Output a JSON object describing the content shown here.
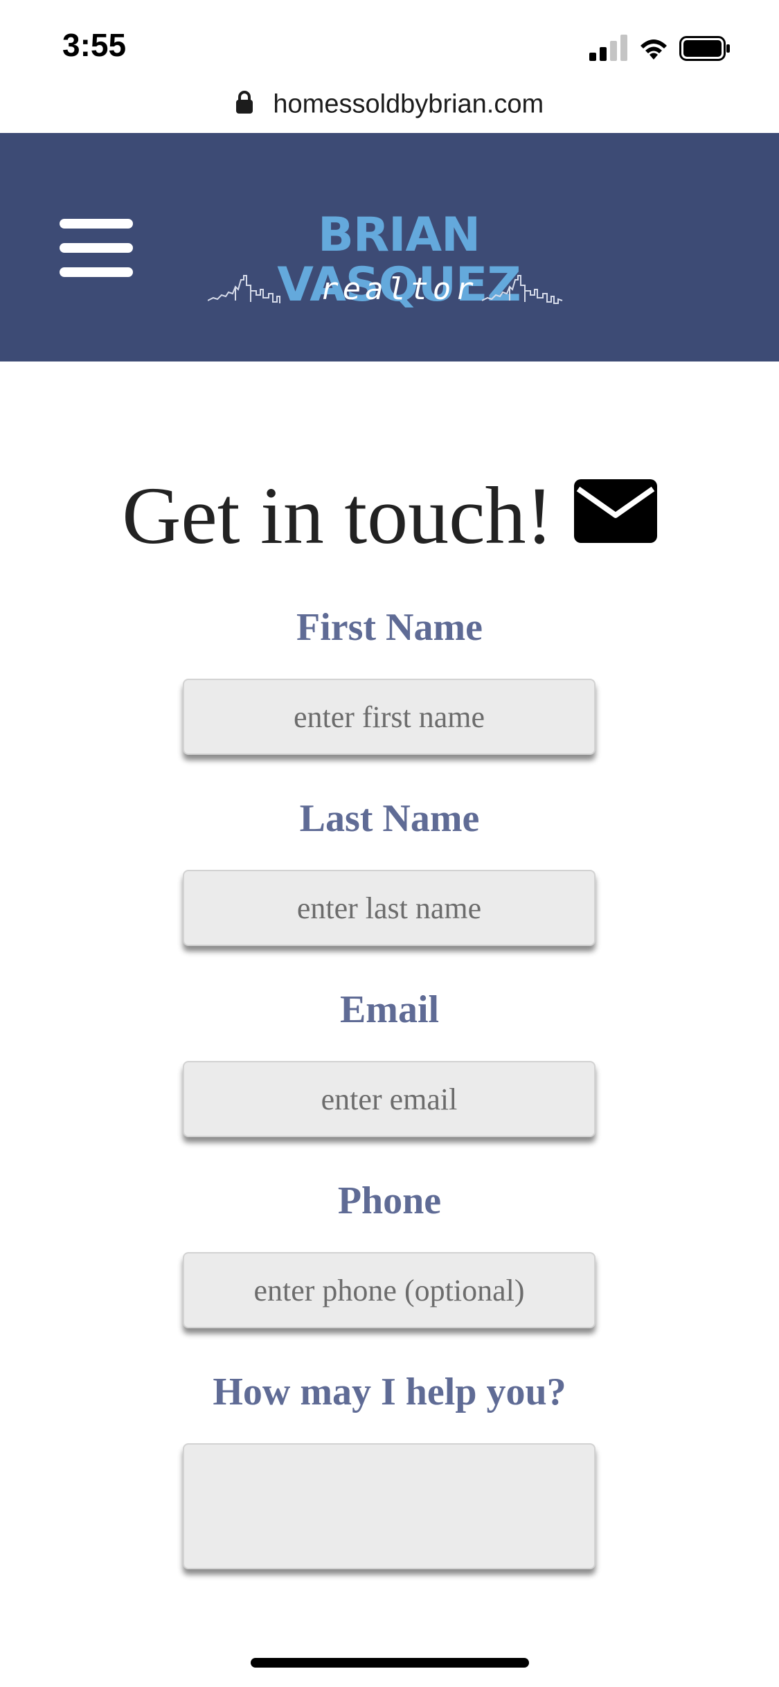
{
  "status_bar": {
    "time": "3:55",
    "icons": [
      "signal-icon",
      "wifi-icon",
      "battery-icon"
    ]
  },
  "browser": {
    "url": "homessoldbybrian.com",
    "lock_icon": "lock-icon"
  },
  "header": {
    "background_color": "#3d4b75",
    "menu_icon": "hamburger-menu-icon",
    "logo_name": "BRIAN VASQUEZ",
    "logo_tagline": "realtor",
    "logo_color": "#64a9dc"
  },
  "contact_form": {
    "title": "Get in touch!",
    "title_icon": "envelope-icon",
    "label_color": "#5f6b95",
    "fields": {
      "first_name": {
        "label": "First Name",
        "placeholder": "enter first name",
        "value": ""
      },
      "last_name": {
        "label": "Last Name",
        "placeholder": "enter last name",
        "value": ""
      },
      "email": {
        "label": "Email",
        "placeholder": "enter email",
        "value": ""
      },
      "phone": {
        "label": "Phone",
        "placeholder": "enter phone (optional)",
        "value": ""
      },
      "message": {
        "label": "How may I help you?",
        "placeholder": "",
        "value": ""
      }
    }
  }
}
